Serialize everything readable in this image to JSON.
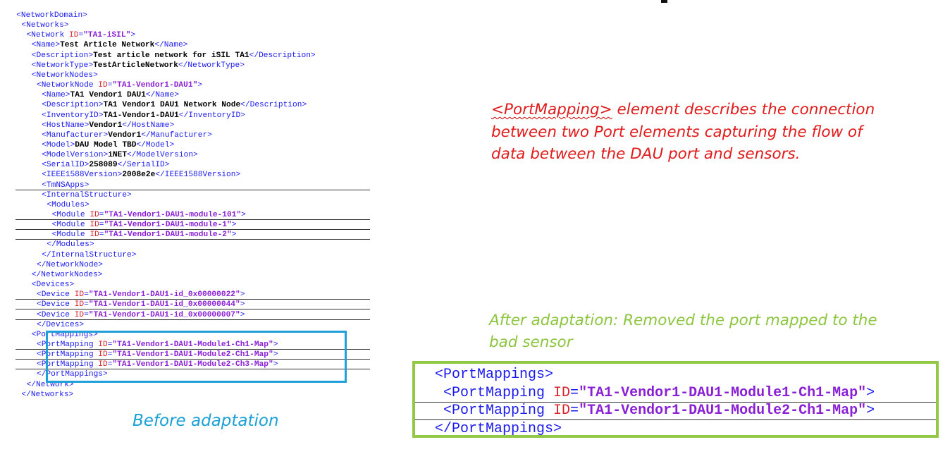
{
  "xml_before": [
    {
      "indent": 2,
      "parts": [
        [
          "tag",
          "<NetworkDomain>"
        ]
      ]
    },
    {
      "indent": 4,
      "parts": [
        [
          "tag",
          "<Networks>"
        ]
      ]
    },
    {
      "indent": 6,
      "parts": [
        [
          "tag",
          "<Network "
        ],
        [
          "attr",
          "ID"
        ],
        [
          "tag",
          "="
        ],
        [
          "val",
          "\"TA1-iSIL\""
        ],
        [
          "tag",
          ">"
        ]
      ]
    },
    {
      "indent": 8,
      "parts": [
        [
          "tag",
          "<Name>"
        ],
        [
          "txt",
          "Test Article Network"
        ],
        [
          "tag",
          "</Name>"
        ]
      ]
    },
    {
      "indent": 8,
      "parts": [
        [
          "tag",
          "<Description>"
        ],
        [
          "txt",
          "Test article network for iSIL TA1"
        ],
        [
          "tag",
          "</Description>"
        ]
      ]
    },
    {
      "indent": 8,
      "parts": [
        [
          "tag",
          "<NetworkType>"
        ],
        [
          "txt",
          "TestArticleNetwork"
        ],
        [
          "tag",
          "</NetworkType>"
        ]
      ]
    },
    {
      "indent": 8,
      "parts": [
        [
          "tag",
          "<NetworkNodes>"
        ]
      ]
    },
    {
      "indent": 10,
      "parts": [
        [
          "tag",
          "<NetworkNode "
        ],
        [
          "attr",
          "ID"
        ],
        [
          "tag",
          "="
        ],
        [
          "val",
          "\"TA1-Vendor1-DAU1\""
        ],
        [
          "tag",
          ">"
        ]
      ]
    },
    {
      "indent": 12,
      "parts": [
        [
          "tag",
          "<Name>"
        ],
        [
          "txt",
          "TA1 Vendor1 DAU1"
        ],
        [
          "tag",
          "</Name>"
        ]
      ]
    },
    {
      "indent": 12,
      "parts": [
        [
          "tag",
          "<Description>"
        ],
        [
          "txt",
          "TA1 Vendor1 DAU1 Network Node"
        ],
        [
          "tag",
          "</Description>"
        ]
      ]
    },
    {
      "indent": 12,
      "parts": [
        [
          "tag",
          "<InventoryID>"
        ],
        [
          "txt",
          "TA1-Vendor1-DAU1"
        ],
        [
          "tag",
          "</InventoryID>"
        ]
      ]
    },
    {
      "indent": 12,
      "parts": [
        [
          "tag",
          "<HostName>"
        ],
        [
          "txt",
          "Vendor1"
        ],
        [
          "tag",
          "</HostName>"
        ]
      ]
    },
    {
      "indent": 12,
      "parts": [
        [
          "tag",
          "<Manufacturer>"
        ],
        [
          "txt",
          "Vendor1"
        ],
        [
          "tag",
          "</Manufacturer>"
        ]
      ]
    },
    {
      "indent": 12,
      "parts": [
        [
          "tag",
          "<Model>"
        ],
        [
          "txt",
          "DAU Model TBD"
        ],
        [
          "tag",
          "</Model>"
        ]
      ]
    },
    {
      "indent": 12,
      "parts": [
        [
          "tag",
          "<ModelVersion>"
        ],
        [
          "txt",
          "iNET"
        ],
        [
          "tag",
          "</ModelVersion>"
        ]
      ]
    },
    {
      "indent": 12,
      "parts": [
        [
          "tag",
          "<SerialID>"
        ],
        [
          "txt",
          "258089"
        ],
        [
          "tag",
          "</SerialID>"
        ]
      ]
    },
    {
      "indent": 12,
      "parts": [
        [
          "tag",
          "<IEEE1588Version>"
        ],
        [
          "txt",
          "2008e2e"
        ],
        [
          "tag",
          "</IEEE1588Version>"
        ]
      ]
    },
    {
      "indent": 12,
      "parts": [
        [
          "tag",
          "<TmNSApps>"
        ]
      ]
    },
    {
      "indent": 12,
      "parts": [
        [
          "tag",
          "<InternalStructure>"
        ]
      ]
    },
    {
      "indent": 14,
      "parts": [
        [
          "tag",
          "<Modules>"
        ]
      ]
    },
    {
      "indent": 16,
      "parts": [
        [
          "tag",
          "<Module "
        ],
        [
          "attr",
          "ID"
        ],
        [
          "tag",
          "="
        ],
        [
          "val",
          "\"TA1-Vendor1-DAU1-module-101\""
        ],
        [
          "tag",
          ">"
        ]
      ]
    },
    {
      "indent": 16,
      "parts": [
        [
          "tag",
          "<Module "
        ],
        [
          "attr",
          "ID"
        ],
        [
          "tag",
          "="
        ],
        [
          "val",
          "\"TA1-Vendor1-DAU1-module-1\""
        ],
        [
          "tag",
          ">"
        ]
      ]
    },
    {
      "indent": 16,
      "parts": [
        [
          "tag",
          "<Module "
        ],
        [
          "attr",
          "ID"
        ],
        [
          "tag",
          "="
        ],
        [
          "val",
          "\"TA1-Vendor1-DAU1-module-2\""
        ],
        [
          "tag",
          ">"
        ]
      ]
    },
    {
      "indent": 14,
      "parts": [
        [
          "tag",
          "</Modules>"
        ]
      ]
    },
    {
      "indent": 12,
      "parts": [
        [
          "tag",
          "</InternalStructure>"
        ]
      ]
    },
    {
      "indent": 10,
      "parts": [
        [
          "tag",
          "</NetworkNode>"
        ]
      ]
    },
    {
      "indent": 8,
      "parts": [
        [
          "tag",
          "</NetworkNodes>"
        ]
      ]
    },
    {
      "indent": 8,
      "parts": [
        [
          "tag",
          "<Devices>"
        ]
      ]
    },
    {
      "indent": 10,
      "parts": [
        [
          "tag",
          "<Device "
        ],
        [
          "attr",
          "ID"
        ],
        [
          "tag",
          "="
        ],
        [
          "val",
          "\"TA1-Vendor1-DAU1-id_0x00000022\""
        ],
        [
          "tag",
          ">"
        ]
      ]
    },
    {
      "indent": 10,
      "parts": [
        [
          "tag",
          "<Device "
        ],
        [
          "attr",
          "ID"
        ],
        [
          "tag",
          "="
        ],
        [
          "val",
          "\"TA1-Vendor1-DAU1-id_0x00000044\""
        ],
        [
          "tag",
          ">"
        ]
      ]
    },
    {
      "indent": 10,
      "parts": [
        [
          "tag",
          "<Device "
        ],
        [
          "attr",
          "ID"
        ],
        [
          "tag",
          "="
        ],
        [
          "val",
          "\"TA1-Vendor1-DAU1-id_0x00000007\""
        ],
        [
          "tag",
          ">"
        ]
      ]
    },
    {
      "indent": 10,
      "parts": [
        [
          "tag",
          "</Devices>"
        ]
      ]
    },
    {
      "indent": 8,
      "parts": [
        [
          "tag",
          "<PortMappings>"
        ]
      ]
    },
    {
      "indent": 10,
      "parts": [
        [
          "tag",
          "<PortMapping "
        ],
        [
          "attr",
          "ID"
        ],
        [
          "tag",
          "="
        ],
        [
          "val",
          "\"TA1-Vendor1-DAU1-Module1-Ch1-Map\""
        ],
        [
          "tag",
          ">"
        ]
      ]
    },
    {
      "indent": 10,
      "parts": [
        [
          "tag",
          "<PortMapping "
        ],
        [
          "attr",
          "ID"
        ],
        [
          "tag",
          "="
        ],
        [
          "val",
          "\"TA1-Vendor1-DAU1-Module2-Ch1-Map\""
        ],
        [
          "tag",
          ">"
        ]
      ]
    },
    {
      "indent": 10,
      "parts": [
        [
          "tag",
          "<PortMapping "
        ],
        [
          "attr",
          "ID"
        ],
        [
          "tag",
          "="
        ],
        [
          "val",
          "\"TA1-Vendor1-DAU1-Module2-Ch3-Map\""
        ],
        [
          "tag",
          ">"
        ]
      ]
    },
    {
      "indent": 10,
      "parts": [
        [
          "tag",
          "</PortMappings>"
        ]
      ]
    },
    {
      "indent": 6,
      "parts": [
        [
          "tag",
          "</Network>"
        ]
      ]
    },
    {
      "indent": 4,
      "parts": [
        [
          "tag",
          "</Networks>"
        ]
      ]
    }
  ],
  "caption_before": "Before adaptation",
  "description": {
    "tag_word": "<PortMapping>",
    "rest": " element describes the connection between two Port elements capturing the flow of data between the DAU port and sensors."
  },
  "caption_after": "After adaptation: Removed the port mapped to the bad sensor",
  "xml_after": [
    {
      "indent": 2,
      "parts": [
        [
          "tag",
          "<PortMappings>"
        ]
      ]
    },
    {
      "indent": 4,
      "parts": [
        [
          "tag",
          "<PortMapping "
        ],
        [
          "attr",
          "ID"
        ],
        [
          "tag",
          "="
        ],
        [
          "val",
          "\"TA1-Vendor1-DAU1-Module1-Ch1-Map\""
        ],
        [
          "tag",
          ">"
        ]
      ]
    },
    {
      "indent": 4,
      "parts": [
        [
          "tag",
          "<PortMapping "
        ],
        [
          "attr",
          "ID"
        ],
        [
          "tag",
          "="
        ],
        [
          "val",
          "\"TA1-Vendor1-DAU1-Module2-Ch1-Map\""
        ],
        [
          "tag",
          ">"
        ]
      ]
    },
    {
      "indent": 2,
      "parts": [
        [
          "tag",
          "</PortMappings>"
        ]
      ]
    }
  ],
  "colors": {
    "tag": "#1a1aee",
    "attr": "#d8232a",
    "value": "#8a1fd6",
    "before_highlight": "#1fa0d8",
    "after_highlight": "#92c846",
    "description_text": "#e01b1b"
  }
}
